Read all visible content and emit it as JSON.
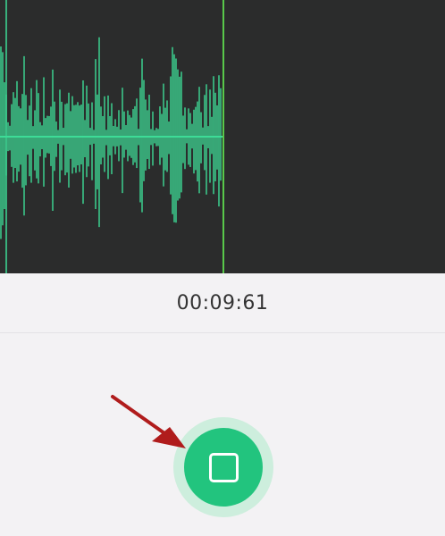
{
  "recorder": {
    "elapsed_time": "00:09:61",
    "stop_button_icon": "stop-square-icon"
  },
  "colors": {
    "waveform": "#3ddc97",
    "playhead": "#58c84a",
    "panel_background": "#2b2c2c",
    "accent": "#22c47e",
    "annotation_arrow": "#b01c1c"
  },
  "annotation": {
    "type": "arrow",
    "points_to": "stop-button"
  }
}
